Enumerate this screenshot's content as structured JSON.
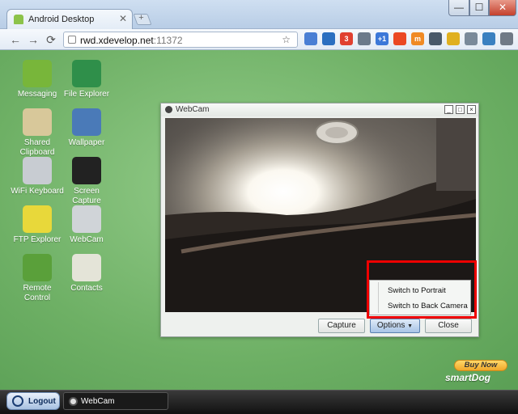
{
  "browser": {
    "tab_title": "Android Desktop",
    "tab_close": "✕",
    "new_tab": "+",
    "url_host": "rwd.xdevelop.net",
    "url_port": ":11372",
    "window_controls": {
      "minimize": "—",
      "maximize": "☐",
      "close": "✕"
    },
    "nav": {
      "back": "←",
      "forward": "→",
      "reload": "⟳"
    },
    "omnibox_tools": "☆",
    "extensions": [
      {
        "name": "translate-icon",
        "color": "#4a7fd4",
        "label": ""
      },
      {
        "name": "x-icon",
        "color": "#2b6fc0",
        "label": ""
      },
      {
        "name": "badge-3-icon",
        "color": "#e04030",
        "label": "3"
      },
      {
        "name": "headphones-icon",
        "color": "#6b7a8a",
        "label": ""
      },
      {
        "name": "plus-one-icon",
        "color": "#3c78d8",
        "label": "+1"
      },
      {
        "name": "stumble-icon",
        "color": "#eb4823",
        "label": ""
      },
      {
        "name": "m-icon",
        "color": "#f08a24",
        "label": "m"
      },
      {
        "name": "phone-icon",
        "color": "#4a5a6a",
        "label": ""
      },
      {
        "name": "lightbulb-icon",
        "color": "#e0b020",
        "label": ""
      },
      {
        "name": "cloud-icon",
        "color": "#7a8a9a",
        "label": ""
      },
      {
        "name": "device-icon",
        "color": "#3a80c0",
        "label": ""
      },
      {
        "name": "settings-icon",
        "color": "#707a86",
        "label": ""
      }
    ]
  },
  "desktop": {
    "icons": [
      {
        "name": "messaging",
        "label": "Messaging",
        "color": "#78b63a"
      },
      {
        "name": "file-explorer",
        "label": "File Explorer",
        "color": "#2f8f4a"
      },
      {
        "name": "shared-clipboard",
        "label": "Shared Clipboard",
        "color": "#d8c89a"
      },
      {
        "name": "wallpaper",
        "label": "Wallpaper",
        "color": "#4a7ab8"
      },
      {
        "name": "wifi-keyboard",
        "label": "WiFi Keyboard",
        "color": "#c8ccd2"
      },
      {
        "name": "screen-capture",
        "label": "Screen Capture",
        "color": "#222222"
      },
      {
        "name": "ftp-explorer",
        "label": "FTP Explorer",
        "color": "#e8d83a"
      },
      {
        "name": "webcam",
        "label": "WebCam",
        "color": "#d0d4d8"
      },
      {
        "name": "remote-control",
        "label": "Remote Control",
        "color": "#5aa03a"
      },
      {
        "name": "contacts",
        "label": "Contacts",
        "color": "#e4e4d8"
      }
    ]
  },
  "webcam_window": {
    "title": "WebCam",
    "controls": {
      "minimize": "_",
      "maximize": "□",
      "close": "×"
    },
    "buttons": {
      "capture": "Capture",
      "options": "Options",
      "close": "Close"
    },
    "options_menu": [
      "Switch to Portrait",
      "Switch to Back Camera"
    ]
  },
  "promo": {
    "buy_now": "Buy Now",
    "brand": "smartDog"
  },
  "taskbar": {
    "logout": "Logout",
    "running_app": "WebCam"
  }
}
